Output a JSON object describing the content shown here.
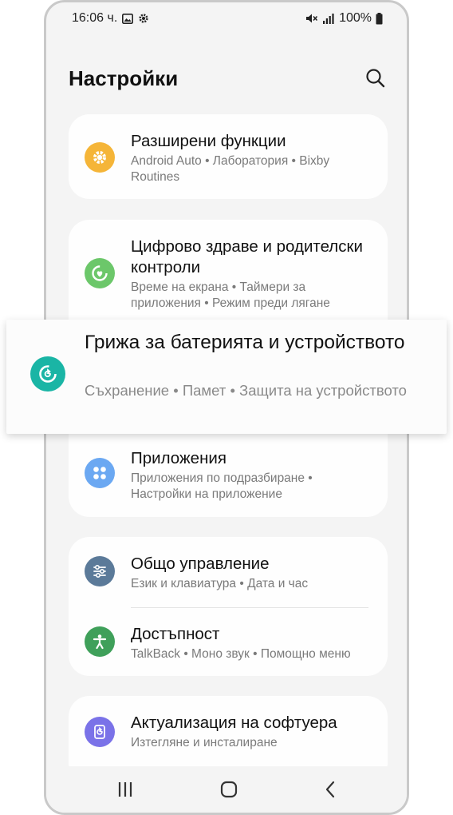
{
  "status_bar": {
    "time": "16:06 ч.",
    "battery": "100%",
    "icons": [
      "image-icon",
      "gear-icon",
      "mute-icon",
      "signal-icon",
      "battery-icon"
    ]
  },
  "header": {
    "title": "Настройки",
    "search_icon": "search-icon"
  },
  "items": [
    {
      "title": "Разширени функции",
      "subtitle": "Android Auto  •  Лаборатория  •  Bixby Routines",
      "icon": "puzzle-gear-icon",
      "color": "#f5b538"
    },
    {
      "title": "Цифрово здраве и родителски контроли",
      "subtitle": "Време на екрана  •  Таймери за приложения  •  Режим преди лягане",
      "icon": "heart-ring-icon",
      "color": "#6cc76a"
    },
    {
      "title": "Приложения",
      "subtitle": "Приложения по подразбиране  •  Настройки на приложение",
      "icon": "apps-grid-icon",
      "color": "#6ba8f2"
    },
    {
      "title": "Общо управление",
      "subtitle": "Език и клавиатура  •  Дата и час",
      "icon": "sliders-icon",
      "color": "#5b7a99"
    },
    {
      "title": "Достъпност",
      "subtitle": "TalkBack  •  Моно звук  •  Помощно меню",
      "icon": "accessibility-icon",
      "color": "#3fa05a"
    },
    {
      "title": "Актуализация на софтуера",
      "subtitle": "Изтегляне и инсталиране",
      "icon": "software-update-icon",
      "color": "#7a72e8"
    }
  ],
  "highlight": {
    "title": "Грижа за батерията и устройството",
    "subtitle": "Съхранение  •  Памет  •  Защита на устройството",
    "icon": "device-care-icon",
    "color": "#1ab5a5"
  },
  "navbar": {
    "icons": [
      "recents-icon",
      "home-icon",
      "back-icon"
    ]
  }
}
